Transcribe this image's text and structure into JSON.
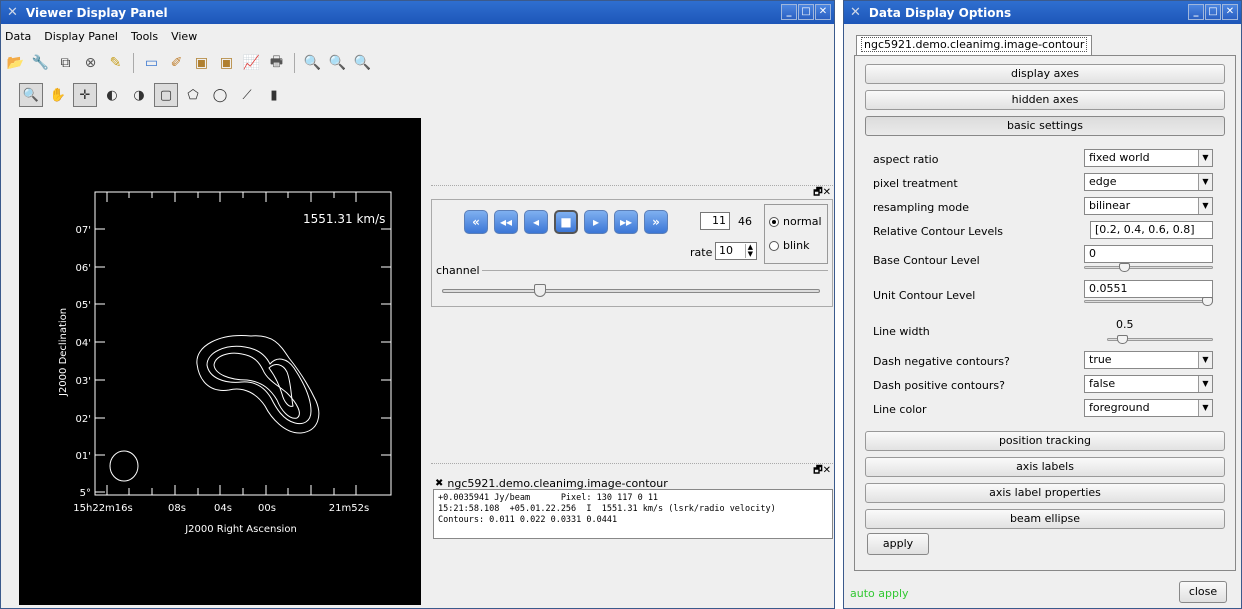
{
  "viewer": {
    "title": "Viewer Display Panel",
    "menu": [
      "Data",
      "Display Panel",
      "Tools",
      "View"
    ],
    "toolbar1_icons": [
      "open-folder-icon",
      "wrench-icon",
      "copy-icon",
      "close-circle-icon",
      "brush-icon",
      "new-panel-icon",
      "panel-options-icon",
      "save-image-icon",
      "print-image-icon",
      "graph-icon",
      "printer-icon",
      "zoom-fit-icon",
      "zoom-in-icon",
      "zoom-out-icon"
    ],
    "toolbar2_icons": [
      "zoom-tool-icon",
      "pan-tool-icon",
      "crosshair-tool-icon",
      "stretch-tool-icon",
      "stretch2-tool-icon",
      "rectangle-tool-icon",
      "polygon-tool-icon",
      "ellipse-tool-icon",
      "polyline-tool-icon",
      "position-tool-icon"
    ],
    "plot": {
      "velocity_label": "1551.31 km/s",
      "y_ticks": [
        "07'",
        "06'",
        "05'",
        "04'",
        "03'",
        "02'",
        "01'",
        "5° "
      ],
      "y_label": "J2000 Declination",
      "x_ticks": [
        "15h22m16s",
        "08s",
        "04s",
        "00s",
        "21m52s"
      ],
      "x_label": "J2000 Right Ascension"
    },
    "animator": {
      "frame": "11",
      "total": "46",
      "rate_label": "rate",
      "rate": "10",
      "modes": [
        {
          "label": "normal",
          "selected": true
        },
        {
          "label": "blink",
          "selected": false
        }
      ],
      "channel_label": "channel",
      "channel_fraction": 0.25
    },
    "tracking": {
      "title": "ngc5921.demo.cleanimg.image-contour",
      "lines": [
        "+0.0035941 Jy/beam      Pixel: 130 117 0 11",
        "15:21:58.108  +05.01.22.256  I  1551.31 km/s (lsrk/radio velocity)",
        "Contours: 0.011 0.022 0.0331 0.0441"
      ]
    }
  },
  "ddo": {
    "title": "Data Display Options",
    "tab": "ngc5921.demo.cleanimg.image-contour",
    "sections_top": [
      "display axes",
      "hidden axes",
      "basic settings"
    ],
    "options": {
      "aspect_ratio": {
        "label": "aspect ratio",
        "value": "fixed world"
      },
      "pixel_treatment": {
        "label": "pixel treatment",
        "value": "edge"
      },
      "resampling_mode": {
        "label": "resampling mode",
        "value": "bilinear"
      },
      "relative_levels": {
        "label": "Relative Contour Levels",
        "value": "[0.2, 0.4, 0.6, 0.8]"
      },
      "base_level": {
        "label": "Base Contour Level",
        "value": "0",
        "slider_fraction": 0.3
      },
      "unit_level": {
        "label": "Unit Contour Level",
        "value": "0.0551",
        "slider_fraction": 1.0
      },
      "line_width": {
        "label": "Line width",
        "value": "0.5",
        "slider_fraction": 0.1
      },
      "dash_negative": {
        "label": "Dash negative contours?",
        "value": "true"
      },
      "dash_positive": {
        "label": "Dash positive contours?",
        "value": "false"
      },
      "line_color": {
        "label": "Line color",
        "value": "foreground"
      }
    },
    "sections_bottom": [
      "position tracking",
      "axis labels",
      "axis label properties",
      "beam ellipse"
    ],
    "apply": "apply",
    "auto_apply": "auto apply",
    "close": "close"
  },
  "colors": {
    "title_bar": "#1d56b8",
    "auto_apply": "#32c832",
    "plot_bg": "#000000"
  }
}
